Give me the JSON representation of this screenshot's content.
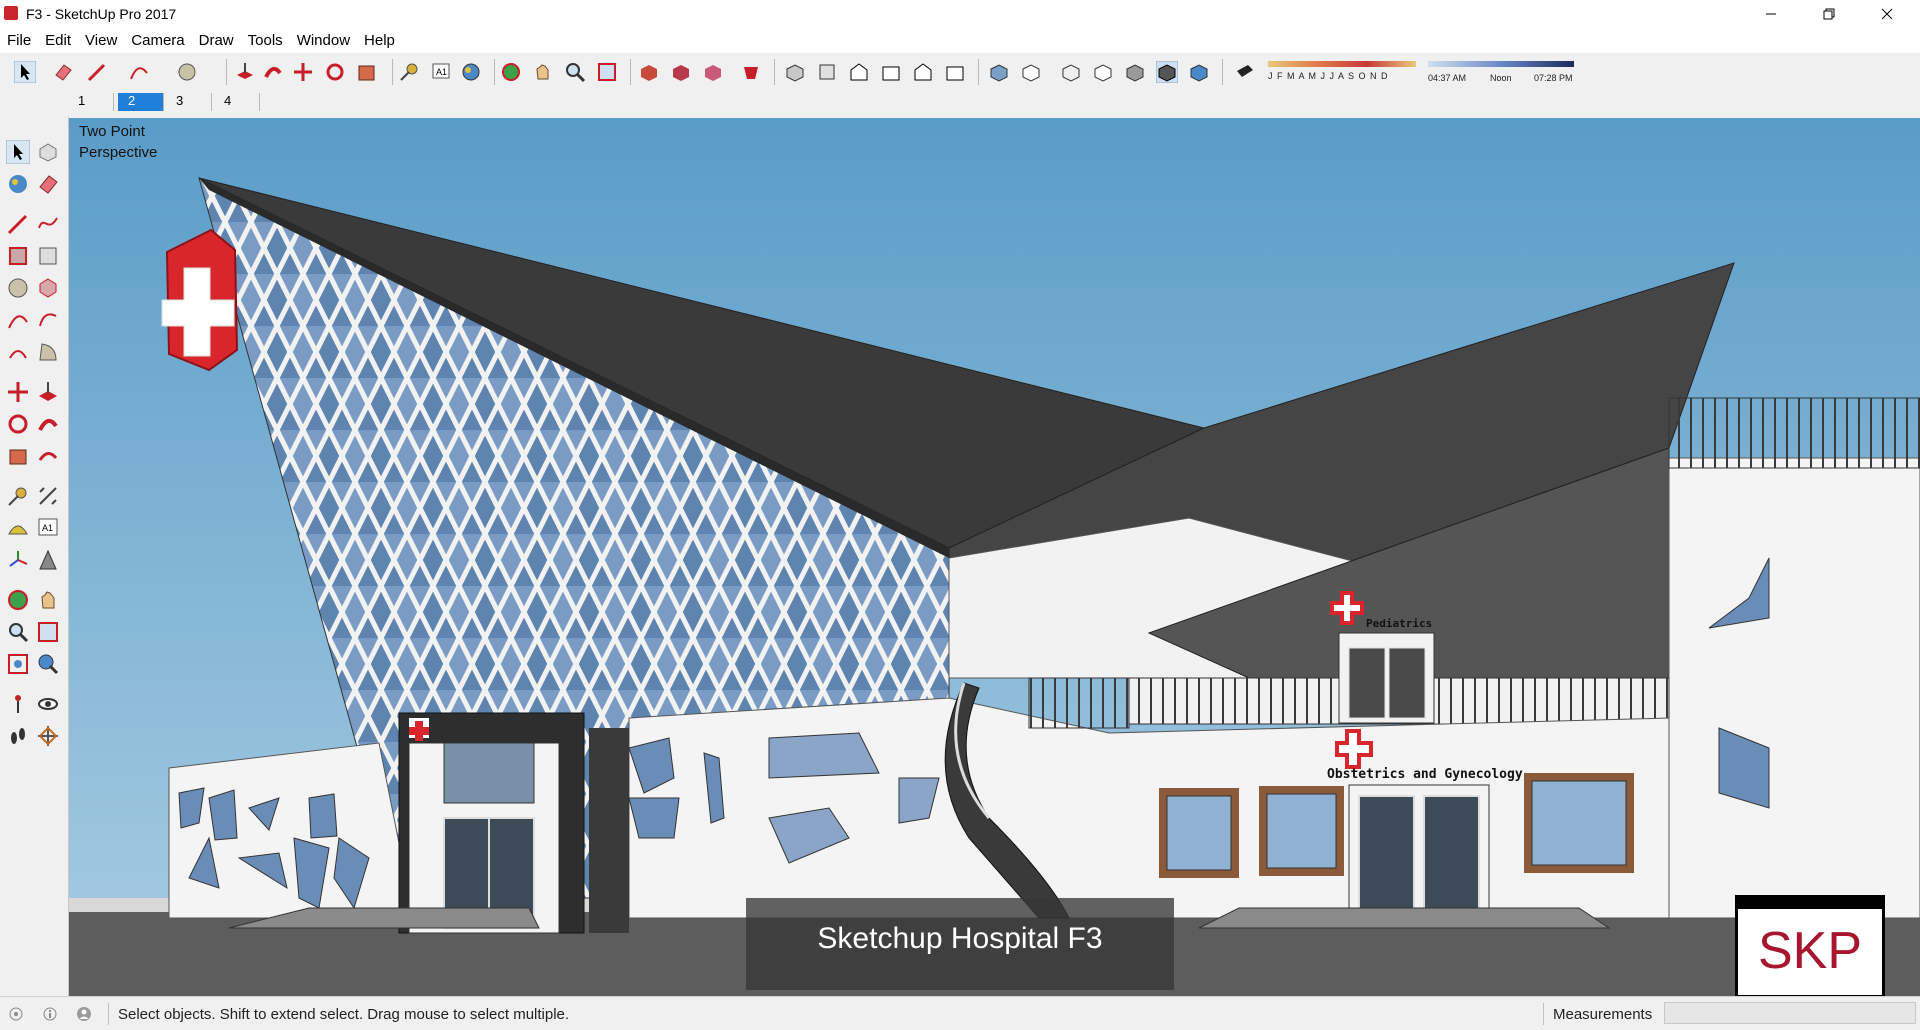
{
  "window": {
    "title": "F3 - SketchUp Pro 2017",
    "minimize_icon": "minimize-icon",
    "maximize_icon": "restore-icon",
    "close_icon": "close-icon"
  },
  "menu": [
    "File",
    "Edit",
    "View",
    "Camera",
    "Draw",
    "Tools",
    "Window",
    "Help"
  ],
  "scenes": {
    "tabs": [
      "1",
      "2",
      "3",
      "4"
    ],
    "active": "2"
  },
  "shadow_settings": {
    "months": "J F M A M J J A S O N D",
    "time_start": "04:37 AM",
    "time_mid": "Noon",
    "time_end": "07:28 PM"
  },
  "viewport": {
    "camera_label_line1": "Two Point",
    "camera_label_line2": "Perspective",
    "sign_pediatrics": "Pediatrics",
    "sign_obgyn": "Obstetrics and Gynecology",
    "caption": "Sketchup Hospital F3",
    "badge": "SKP"
  },
  "status": {
    "message": "Select objects. Shift to extend select. Drag mouse to select multiple.",
    "measurements_label": "Measurements",
    "measurements_value": ""
  },
  "colors": {
    "sky": "#6ba8cf",
    "roof": "#3a3a3a",
    "accent_red": "#d9262c",
    "active_tab": "#1f7fd8"
  }
}
